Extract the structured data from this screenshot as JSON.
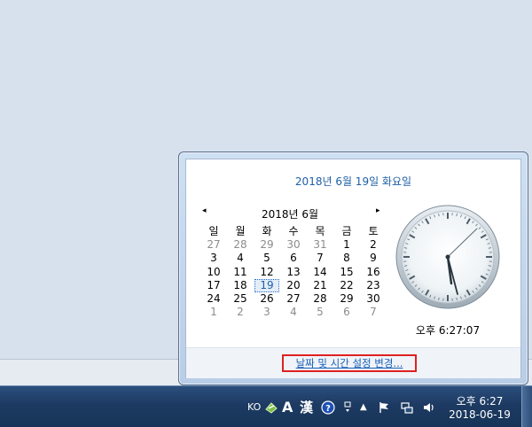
{
  "popup": {
    "full_date": "2018년 6월 19일 화요일",
    "month_label": "2018년 6월",
    "prev_icon": "left-triangle",
    "next_icon": "right-triangle",
    "weekdays": [
      "일",
      "월",
      "화",
      "수",
      "목",
      "금",
      "토"
    ],
    "days": [
      [
        "27",
        "28",
        "29",
        "30",
        "31",
        "1",
        "2"
      ],
      [
        "3",
        "4",
        "5",
        "6",
        "7",
        "8",
        "9"
      ],
      [
        "10",
        "11",
        "12",
        "13",
        "14",
        "15",
        "16"
      ],
      [
        "17",
        "18",
        "19",
        "20",
        "21",
        "22",
        "23"
      ],
      [
        "24",
        "25",
        "26",
        "27",
        "28",
        "29",
        "30"
      ],
      [
        "1",
        "2",
        "3",
        "4",
        "5",
        "6",
        "7"
      ]
    ],
    "today": "19",
    "clock_time": "오후 6:27:07",
    "change_link": "날짜 및 시간 설정 변경..."
  },
  "taskbar": {
    "lang": "KO",
    "ime_mode": "A",
    "ime_hanja": "漢",
    "help": "?",
    "time": "오후 6:27",
    "date": "2018-06-19",
    "icons": [
      "ime-settings-icon",
      "help-icon",
      "ime-menu-icon",
      "show-hidden-icons",
      "action-center-flag-icon",
      "network-icon",
      "volume-icon"
    ]
  },
  "colors": {
    "accent": "#1f5fa6",
    "highlight_border": "#e02020",
    "taskbar": "#1d3a62"
  }
}
